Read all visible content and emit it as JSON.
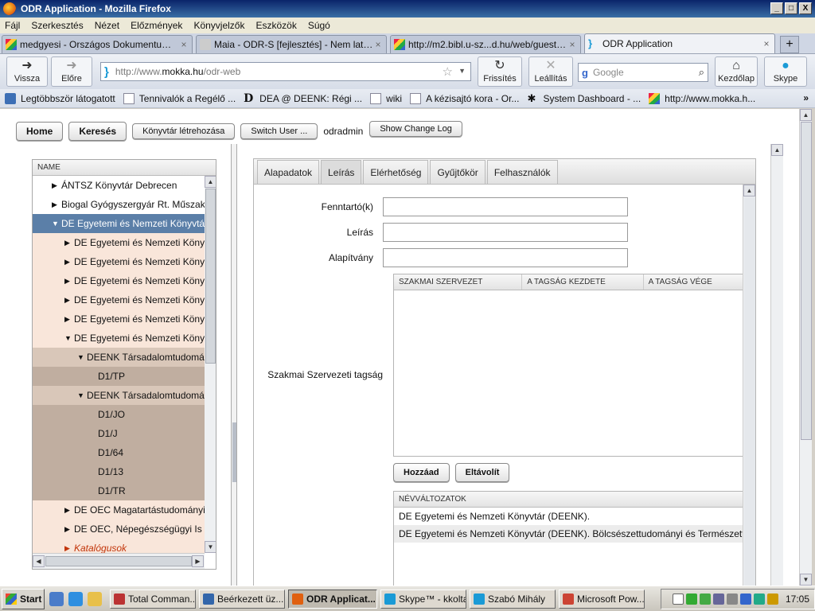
{
  "window": {
    "title": "ODR Application - Mozilla Firefox",
    "min": "_",
    "max": "□",
    "close": "X"
  },
  "menu": [
    "Fájl",
    "Szerkesztés",
    "Nézet",
    "Előzmények",
    "Könyvjelzők",
    "Eszközök",
    "Súgó"
  ],
  "tabs": [
    {
      "label": "medgyesi - Országos Dokumentumellát...",
      "close": "×"
    },
    {
      "label": "Maia - ODR-S [fejlesztés] - Nem latszik ...",
      "close": "×"
    },
    {
      "label": "http://m2.bibl.u-sz...d.hu/web/guest/odr",
      "close": "×"
    },
    {
      "label": "ODR Application",
      "close": "×"
    }
  ],
  "newtab": "+",
  "nav": {
    "back": "Vissza",
    "forward": "Előre",
    "reload": "Frissítés",
    "stop": "Leállítás",
    "home": "Kezdőlap",
    "skype": "Skype",
    "url_prefix": "http://www.",
    "url_domain": "mokka.hu",
    "url_path": "/odr-web",
    "search_placeholder": "Google"
  },
  "bookmarks": [
    "Legtöbbször látogatott",
    "Tennivalók a Regélő ...",
    "DEA @ DEENK: Régi ...",
    "wiki",
    "A kézisajtó kora - Or...",
    "System Dashboard - ...",
    "http://www.mokka.h..."
  ],
  "bookmarks_more": "»",
  "toolbar": {
    "home": "Home",
    "search": "Keresés",
    "create_library": "Könyvtár létrehozása",
    "switch_user": "Switch User ...",
    "username": "odradmin",
    "changelog": "Show Change Log"
  },
  "tree": {
    "header": "NAME",
    "rows": [
      {
        "label": "ÁNTSZ Könyvtár Debrecen",
        "arrow": "▶"
      },
      {
        "label": "Biogal Gyógyszergyár Rt. Műszaki",
        "arrow": "▶"
      },
      {
        "label": "DE Egyetemi és Nemzeti Könyvtár",
        "arrow": "▼"
      },
      {
        "label": "DE Egyetemi és Nemzeti Könyvtár",
        "arrow": "▶"
      },
      {
        "label": "DE Egyetemi és Nemzeti Könyvtár",
        "arrow": "▶"
      },
      {
        "label": "DE Egyetemi és Nemzeti Könyvtár",
        "arrow": "▶"
      },
      {
        "label": "DE Egyetemi és Nemzeti Könyvtár",
        "arrow": "▶"
      },
      {
        "label": "DE Egyetemi és Nemzeti Könyvtár",
        "arrow": "▶"
      },
      {
        "label": "DE Egyetemi és Nemzeti Könyvtár",
        "arrow": "▼"
      },
      {
        "label": "DEENK Társadalomtudományi",
        "arrow": "▼"
      },
      {
        "label": "D1/TP",
        "arrow": ""
      },
      {
        "label": "DEENK Társadalomtudományi",
        "arrow": "▼"
      },
      {
        "label": "D1/JO",
        "arrow": ""
      },
      {
        "label": "D1/J",
        "arrow": ""
      },
      {
        "label": "D1/64",
        "arrow": ""
      },
      {
        "label": "D1/13",
        "arrow": ""
      },
      {
        "label": "D1/TR",
        "arrow": ""
      },
      {
        "label": "DE OEC Magatartástudományi",
        "arrow": "▶"
      },
      {
        "label": "DE OEC, Népegészségügyi Is",
        "arrow": "▶"
      },
      {
        "label": "Katalógusok",
        "arrow": "▶"
      }
    ]
  },
  "detail": {
    "tabs": [
      "Alapadatok",
      "Leírás",
      "Elérhetőség",
      "Gyűjtőkör",
      "Felhasználók"
    ],
    "fields": {
      "maintainer": "Fenntartó(k)",
      "description": "Leírás",
      "foundation": "Alapítvány"
    },
    "member_label": "Szakmai Szervezeti tagság",
    "member_columns": [
      "SZAKMAI SZERVEZET",
      "A TAGSÁG KEZDETE",
      "A TAGSÁG VÉGE"
    ],
    "add": "Hozzáad",
    "remove": "Eltávolít",
    "variants_header": "NÉVVÁLTOZATOK",
    "variants": [
      "DE Egyetemi és Nemzeti Könyvtár (DEENK).",
      "DE Egyetemi és Nemzeti Könyvtár (DEENK). Bölcsészettudományi és Természettudományi"
    ]
  },
  "taskbar": {
    "start": "Start",
    "tasks": [
      "Total Comman...",
      "Beérkezett üz...",
      "ODR Applicat...",
      "Skype™ - kkoltay",
      "Szabó Mihály",
      "Microsoft Pow..."
    ],
    "clock": "17:05"
  },
  "colors": {
    "selected_row": "#5b7fa8",
    "level1": "#f9e6da",
    "level2": "#d9c7b9",
    "level3": "#c0aea0",
    "accent_odr": "#1a9ad6"
  }
}
